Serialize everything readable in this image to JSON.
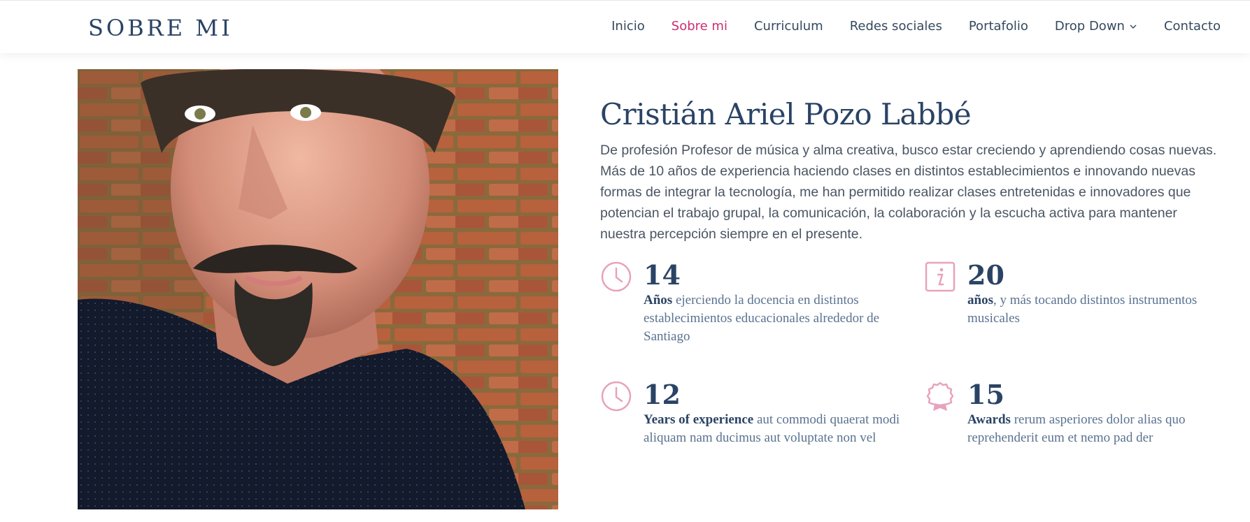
{
  "header": {
    "logo": "SOBRE MI",
    "nav": [
      {
        "label": "Inicio"
      },
      {
        "label": "Sobre mi"
      },
      {
        "label": "Curriculum"
      },
      {
        "label": "Redes sociales"
      },
      {
        "label": "Portafolio"
      },
      {
        "label": "Drop Down"
      },
      {
        "label": "Contacto"
      }
    ],
    "active_color": "#cc2e72"
  },
  "profile": {
    "name": "Cristián Ariel Pozo Labbé",
    "description": "De profesión Profesor de música y alma creativa, busco estar creciendo y aprendiendo cosas nuevas. Más de 10 años de experiencia haciendo clases en distintos establecimientos e innovando nuevas formas de integrar la tecnología, me han permitido realizar clases entretenidas e innovadores que potencian el trabajo grupal, la comunicación, la colaboración y la escucha activa para mantener nuestra percepción siempre en el presente."
  },
  "stats": [
    {
      "icon": "clock-icon",
      "number": "14",
      "bold": "Años",
      "text": " ejerciendo la docencia en distintos establecimientos educacionales alrededor de Santiago"
    },
    {
      "icon": "info-icon",
      "number": "20",
      "bold": "años",
      "text": ", y más tocando distintos instrumentos musicales"
    },
    {
      "icon": "clock-icon",
      "number": "12",
      "bold": "Years of experience",
      "text": " aut commodi quaerat modi aliquam nam ducimus aut voluptate non vel"
    },
    {
      "icon": "award-icon",
      "number": "15",
      "bold": "Awards",
      "text": " rerum asperiores dolor alias quo reprehenderit eum et nemo pad der"
    }
  ],
  "colors": {
    "primary": "#2a4365",
    "accent": "#cc2e72",
    "icon": "#e8a2bd"
  }
}
